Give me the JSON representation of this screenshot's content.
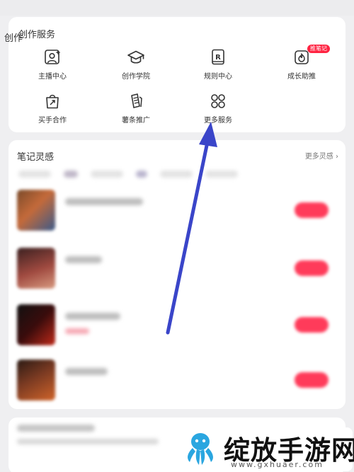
{
  "header": {
    "back_label": "创作"
  },
  "creator_services": {
    "title": "创作服务",
    "items": [
      {
        "label": "主播中心",
        "icon": "host-center-icon"
      },
      {
        "label": "创作学院",
        "icon": "academy-cap-icon"
      },
      {
        "label": "规则中心",
        "icon": "rules-book-icon"
      },
      {
        "label": "成长助推",
        "icon": "flame-boost-icon",
        "badge": "推笔记"
      },
      {
        "label": "买手合作",
        "icon": "bag-arrow-icon"
      },
      {
        "label": "薯条推广",
        "icon": "fries-promo-icon"
      },
      {
        "label": "更多服务",
        "icon": "four-circles-icon"
      }
    ]
  },
  "note_inspiration": {
    "title": "笔记灵感",
    "more_label": "更多灵感 ›"
  },
  "watermark": {
    "title": "绽放手游网",
    "url": "www.gxhuaer.com"
  },
  "colors": {
    "accent": "#ff2442",
    "arrow": "#3a45c9",
    "watermark_blue": "#2aa6e0"
  }
}
